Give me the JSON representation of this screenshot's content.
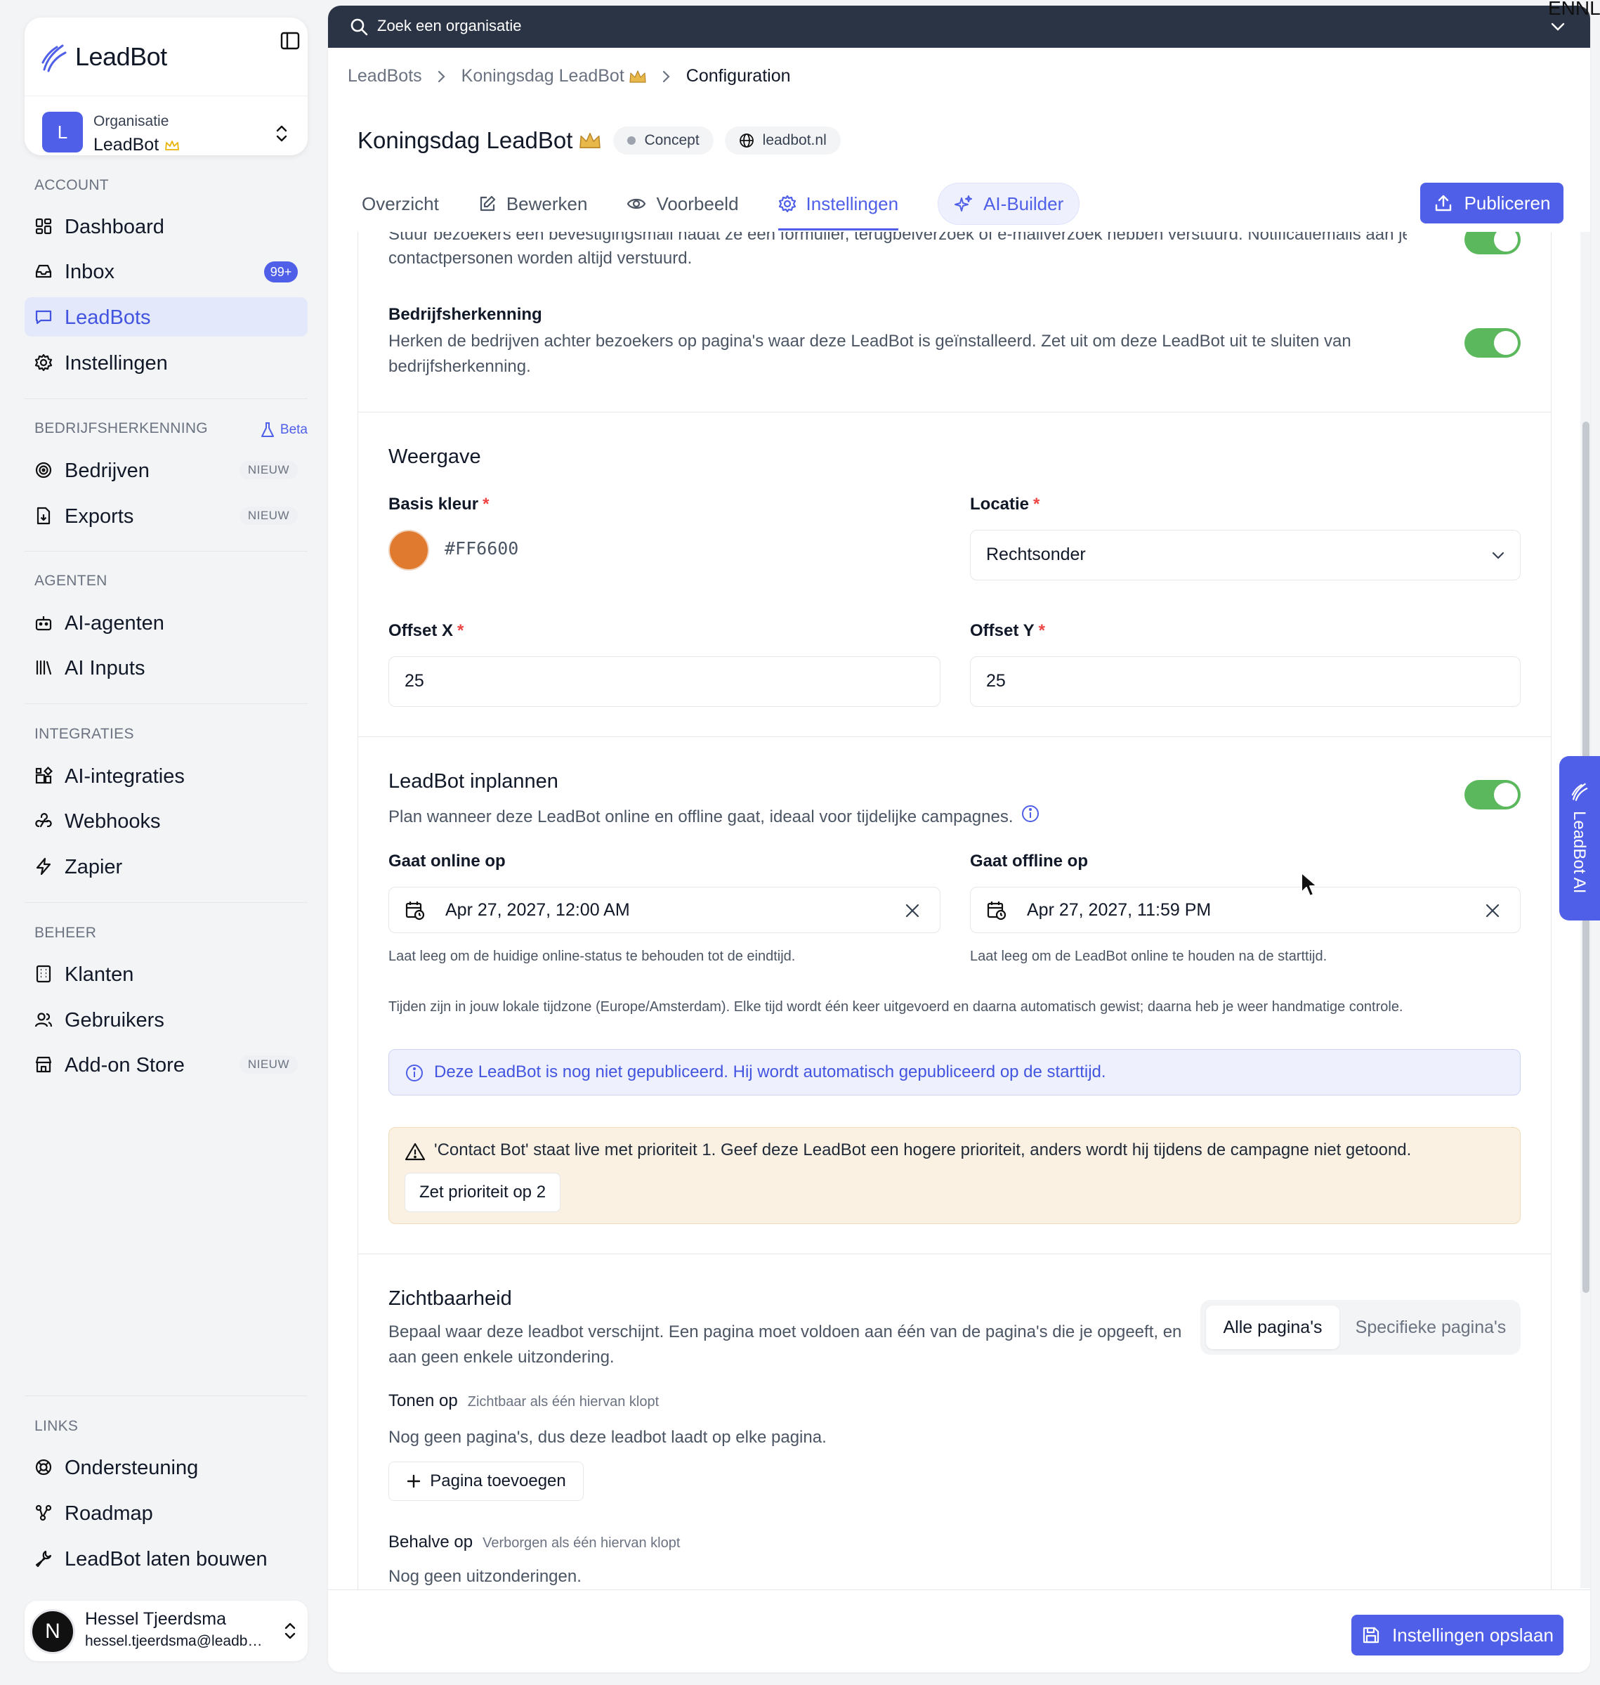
{
  "sidebar": {
    "logo_text": "LeadBot",
    "org": {
      "avatar": "L",
      "label": "Organisatie",
      "name": "LeadBot"
    },
    "sections": {
      "account": "ACCOUNT",
      "bedrijf": "BEDRIJFSHERKENNING",
      "beta": "Beta",
      "agenten": "AGENTEN",
      "integraties": "INTEGRATIES",
      "beheer": "BEHEER",
      "links": "LINKS"
    },
    "items": {
      "dashboard": "Dashboard",
      "inbox": "Inbox",
      "inbox_count": "99+",
      "leadbots": "LeadBots",
      "instellingen": "Instellingen",
      "bedrijven": "Bedrijven",
      "exports": "Exports",
      "ai_agenten": "AI-agenten",
      "ai_inputs": "AI Inputs",
      "ai_integraties": "AI-integraties",
      "webhooks": "Webhooks",
      "zapier": "Zapier",
      "klanten": "Klanten",
      "gebruikers": "Gebruikers",
      "addon": "Add-on Store",
      "ondersteuning": "Ondersteuning",
      "roadmap": "Roadmap",
      "laten_bouwen": "LeadBot laten bouwen"
    },
    "new_badge": "NIEUW",
    "user": {
      "avatar": "N",
      "name": "Hessel Tjeerdsma",
      "email": "hessel.tjeerdsma@leadbot.nl"
    }
  },
  "topbar": {
    "search_placeholder": "Zoek een organisatie",
    "lang": "ENNL"
  },
  "breadcrumb": {
    "root": "LeadBots",
    "bot": "Koningsdag LeadBot",
    "current": "Configuration"
  },
  "header": {
    "title": "Koningsdag LeadBot",
    "status": "Concept",
    "domain": "leadbot.nl"
  },
  "tabs": {
    "overzicht": "Overzicht",
    "bewerken": "Bewerken",
    "voorbeeld": "Voorbeeld",
    "instellingen": "Instellingen",
    "ai_builder": "AI-Builder",
    "publish": "Publiceren"
  },
  "settings": {
    "partial_top": "Stuur bezoekers een bevestigingsmail nadat ze een formulier, terugbelverzoek of e-mailverzoek hebben verstuurd. Notificatiemails aan je",
    "partial_bottom": "contactpersonen worden altijd verstuurd.",
    "bedrijf_title": "Bedrijfsherkenning",
    "bedrijf_desc_1": "Herken de bedrijven achter bezoekers op pagina's waar deze LeadBot is geïnstalleerd. Zet uit om deze LeadBot uit te sluiten van",
    "bedrijf_desc_2": "bedrijfsherkenning.",
    "weergave": {
      "title": "Weergave",
      "basis_kleur_label": "Basis kleur",
      "basis_kleur_value": "#FF6600",
      "locatie_label": "Locatie",
      "locatie_value": "Rechtsonder",
      "offset_x_label": "Offset X",
      "offset_x_value": "25",
      "offset_y_label": "Offset Y",
      "offset_y_value": "25",
      "required_mark": "*"
    },
    "schedule": {
      "title": "LeadBot inplannen",
      "desc": "Plan wanneer deze LeadBot online en offline gaat, ideaal voor tijdelijke campagnes.",
      "online_label": "Gaat online op",
      "online_value": "Apr 27, 2027, 12:00 AM",
      "online_help": "Laat leeg om de huidige online-status te behouden tot de eindtijd.",
      "offline_label": "Gaat offline op",
      "offline_value": "Apr 27, 2027, 11:59 PM",
      "offline_help": "Laat leeg om de LeadBot online te houden na de starttijd.",
      "timezone_note": "Tijden zijn in jouw lokale tijdzone (Europe/Amsterdam). Elke tijd wordt één keer uitgevoerd en daarna automatisch gewist; daarna heb je weer handmatige controle.",
      "info_alert": "Deze LeadBot is nog niet gepubliceerd. Hij wordt automatisch gepubliceerd op de starttijd.",
      "warn_alert": "'Contact Bot' staat live met prioriteit 1. Geef deze LeadBot een hogere prioriteit, anders wordt hij tijdens de campagne niet getoond.",
      "warn_button": "Zet prioriteit op 2"
    },
    "visibility": {
      "title": "Zichtbaarheid",
      "desc_1": "Bepaal waar deze leadbot verschijnt. Een pagina moet voldoen aan één van de pagina's die je opgeeft, en",
      "desc_2": "aan geen enkele uitzondering.",
      "seg_all": "Alle pagina's",
      "seg_specific": "Specifieke pagina's",
      "show_label": "Tonen op",
      "show_hint": "Zichtbaar als één hiervan klopt",
      "show_empty": "Nog geen pagina's, dus deze leadbot laadt op elke pagina.",
      "add_page": "Pagina toevoegen",
      "except_label": "Behalve op",
      "except_hint": "Verborgen als één hiervan klopt",
      "except_empty": "Nog geen uitzonderingen."
    }
  },
  "footer": {
    "save": "Instellingen opslaan"
  },
  "side_tab": "LeadBot AI",
  "colors": {
    "accent": "#4f5fe8",
    "toggle_on": "#5cb85c",
    "swatch": "#e07a2e"
  }
}
